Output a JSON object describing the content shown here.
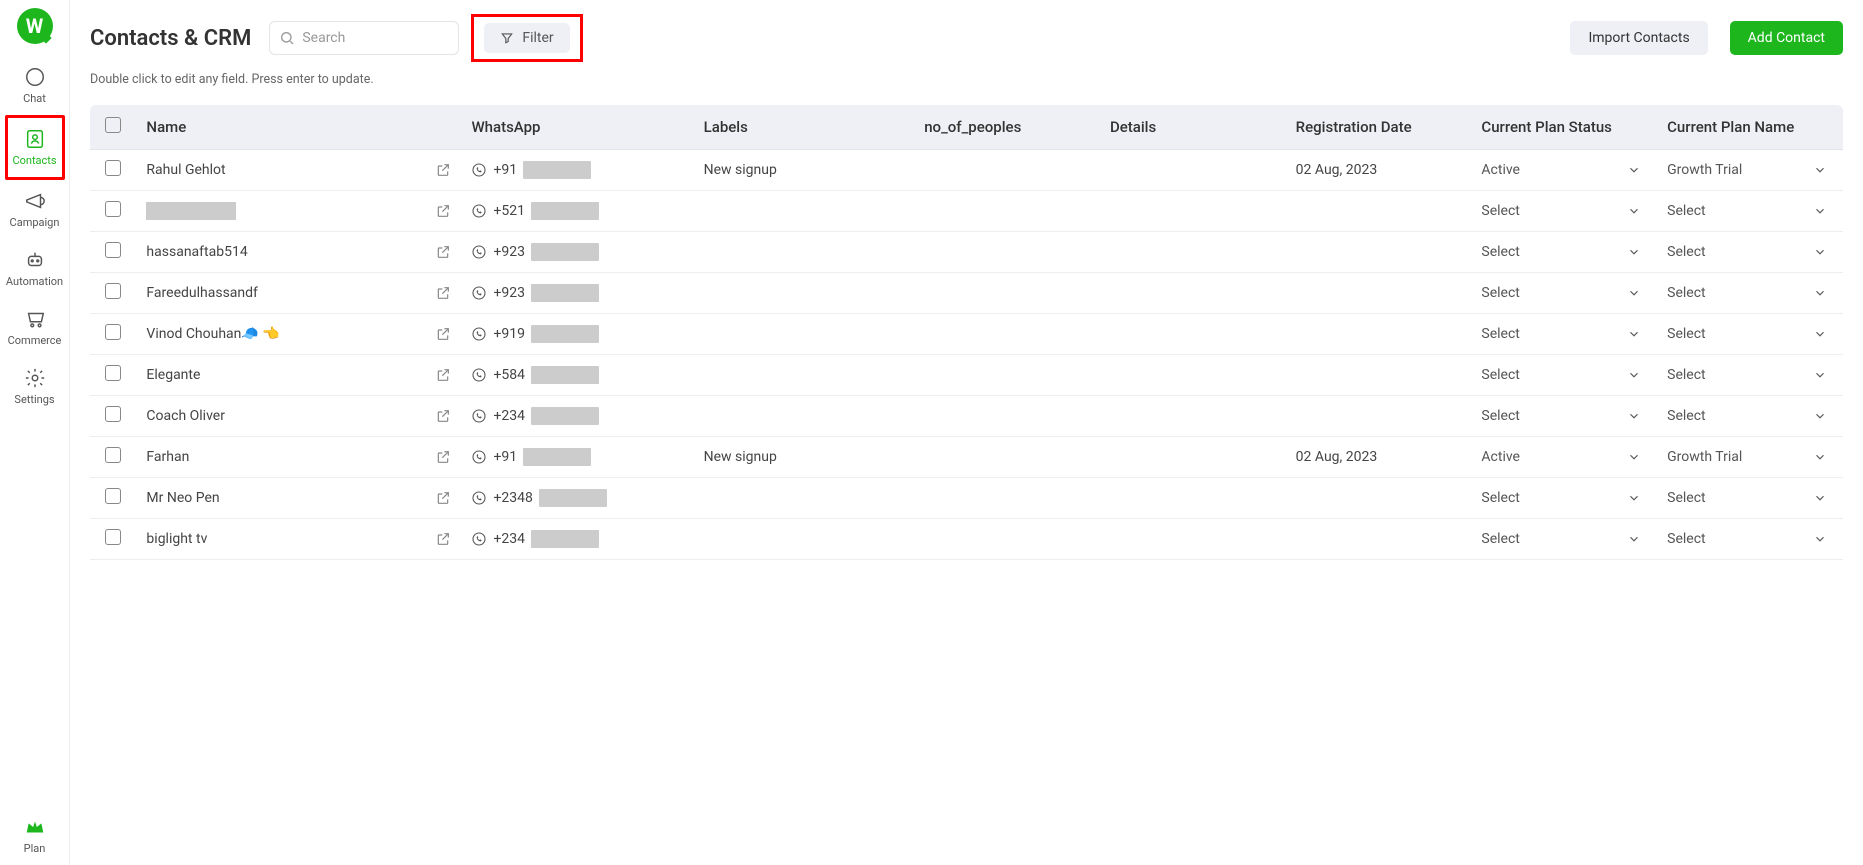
{
  "sidebar": {
    "items": [
      {
        "label": "Chat"
      },
      {
        "label": "Contacts"
      },
      {
        "label": "Campaign"
      },
      {
        "label": "Automation"
      },
      {
        "label": "Commerce"
      },
      {
        "label": "Settings"
      }
    ],
    "plan_label": "Plan"
  },
  "header": {
    "title": "Contacts & CRM",
    "subtitle": "Double click to edit any field. Press enter to update.",
    "search_placeholder": "Search",
    "filter_label": "Filter",
    "import_label": "Import Contacts",
    "add_label": "Add Contact"
  },
  "columns": {
    "name": "Name",
    "whatsapp": "WhatsApp",
    "labels": "Labels",
    "people": "no_of_peoples",
    "details": "Details",
    "reg": "Registration Date",
    "status": "Current Plan Status",
    "plan": "Current Plan Name"
  },
  "select_default": "Select",
  "rows": [
    {
      "name": "Rahul Gehlot",
      "wa_prefix": "+91",
      "labels": "New signup",
      "reg": "02 Aug, 2023",
      "status": "Active",
      "plan": "Growth Trial"
    },
    {
      "name_redacted": true,
      "wa_prefix": "+521",
      "labels": "",
      "reg": "",
      "status": "Select",
      "plan": "Select"
    },
    {
      "name": "hassanaftab514",
      "wa_prefix": "+923",
      "labels": "",
      "reg": "",
      "status": "Select",
      "plan": "Select"
    },
    {
      "name": "Fareedulhassandf",
      "wa_prefix": "+923",
      "labels": "",
      "reg": "",
      "status": "Select",
      "plan": "Select"
    },
    {
      "name": "Vinod Chouhan🧢 👈",
      "wa_prefix": "+919",
      "labels": "",
      "reg": "",
      "status": "Select",
      "plan": "Select"
    },
    {
      "name": "Elegante",
      "wa_prefix": "+584",
      "labels": "",
      "reg": "",
      "status": "Select",
      "plan": "Select"
    },
    {
      "name": "Coach Oliver",
      "wa_prefix": "+234",
      "labels": "",
      "reg": "",
      "status": "Select",
      "plan": "Select"
    },
    {
      "name": "Farhan",
      "wa_prefix": "+91",
      "labels": "New signup",
      "reg": "02 Aug, 2023",
      "status": "Active",
      "plan": "Growth Trial"
    },
    {
      "name": "Mr Neo Pen",
      "wa_prefix": "+2348",
      "labels": "",
      "reg": "",
      "status": "Select",
      "plan": "Select"
    },
    {
      "name": "biglight tv",
      "wa_prefix": "+234",
      "labels": "",
      "reg": "",
      "status": "Select",
      "plan": "Select"
    }
  ]
}
